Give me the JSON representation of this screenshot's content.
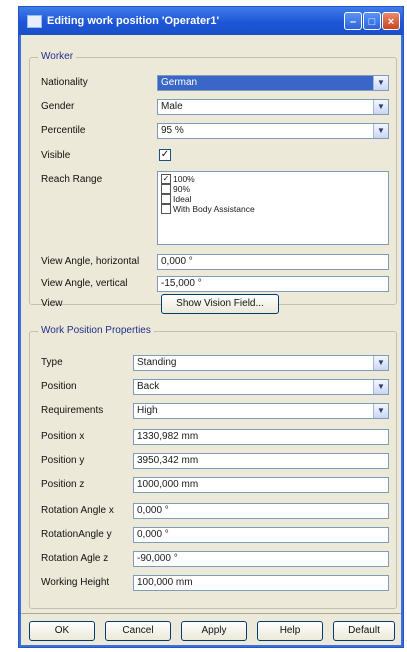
{
  "window": {
    "title": "Editing work position 'Operater1'"
  },
  "worker": {
    "group_title": "Worker",
    "nationality_label": "Nationality",
    "nationality_value": "German",
    "gender_label": "Gender",
    "gender_value": "Male",
    "percentile_label": "Percentile",
    "percentile_value": "95 %",
    "visible_label": "Visible",
    "visible_checked": true,
    "reach_range_label": "Reach Range",
    "reach_range_options": [
      {
        "label": "100%",
        "checked": true
      },
      {
        "label": "90%",
        "checked": false
      },
      {
        "label": "Ideal",
        "checked": false
      },
      {
        "label": "With Body Assistance",
        "checked": false
      }
    ],
    "view_angle_h_label": "View Angle, horizontal",
    "view_angle_h_value": "0,000 °",
    "view_angle_v_label": "View Angle, vertical",
    "view_angle_v_value": "-15,000 °",
    "view_label": "View",
    "show_vision_field_button": "Show Vision Field..."
  },
  "work_position": {
    "group_title": "Work Position Properties",
    "type_label": "Type",
    "type_value": "Standing",
    "position_label": "Position",
    "position_value": "Back",
    "requirements_label": "Requirements",
    "requirements_value": "High",
    "position_x_label": "Position x",
    "position_x_value": "1330,982 mm",
    "position_y_label": "Position y",
    "position_y_value": "3950,342 mm",
    "position_z_label": "Position z",
    "position_z_value": "1000,000 mm",
    "rotation_x_label": "Rotation Angle x",
    "rotation_x_value": "0,000 °",
    "rotation_y_label": "RotationAngle y",
    "rotation_y_value": "0,000 °",
    "rotation_z_label": "Rotation Agle z",
    "rotation_z_value": "-90,000 °",
    "working_height_label": "Working Height",
    "working_height_value": "100,000 mm"
  },
  "buttons": {
    "ok": "OK",
    "cancel": "Cancel",
    "apply": "Apply",
    "help": "Help",
    "default": "Default"
  },
  "colors": {
    "titlebar": "#1d56d6",
    "dialog_bg": "#ece9d8",
    "selection": "#3a66c7"
  }
}
